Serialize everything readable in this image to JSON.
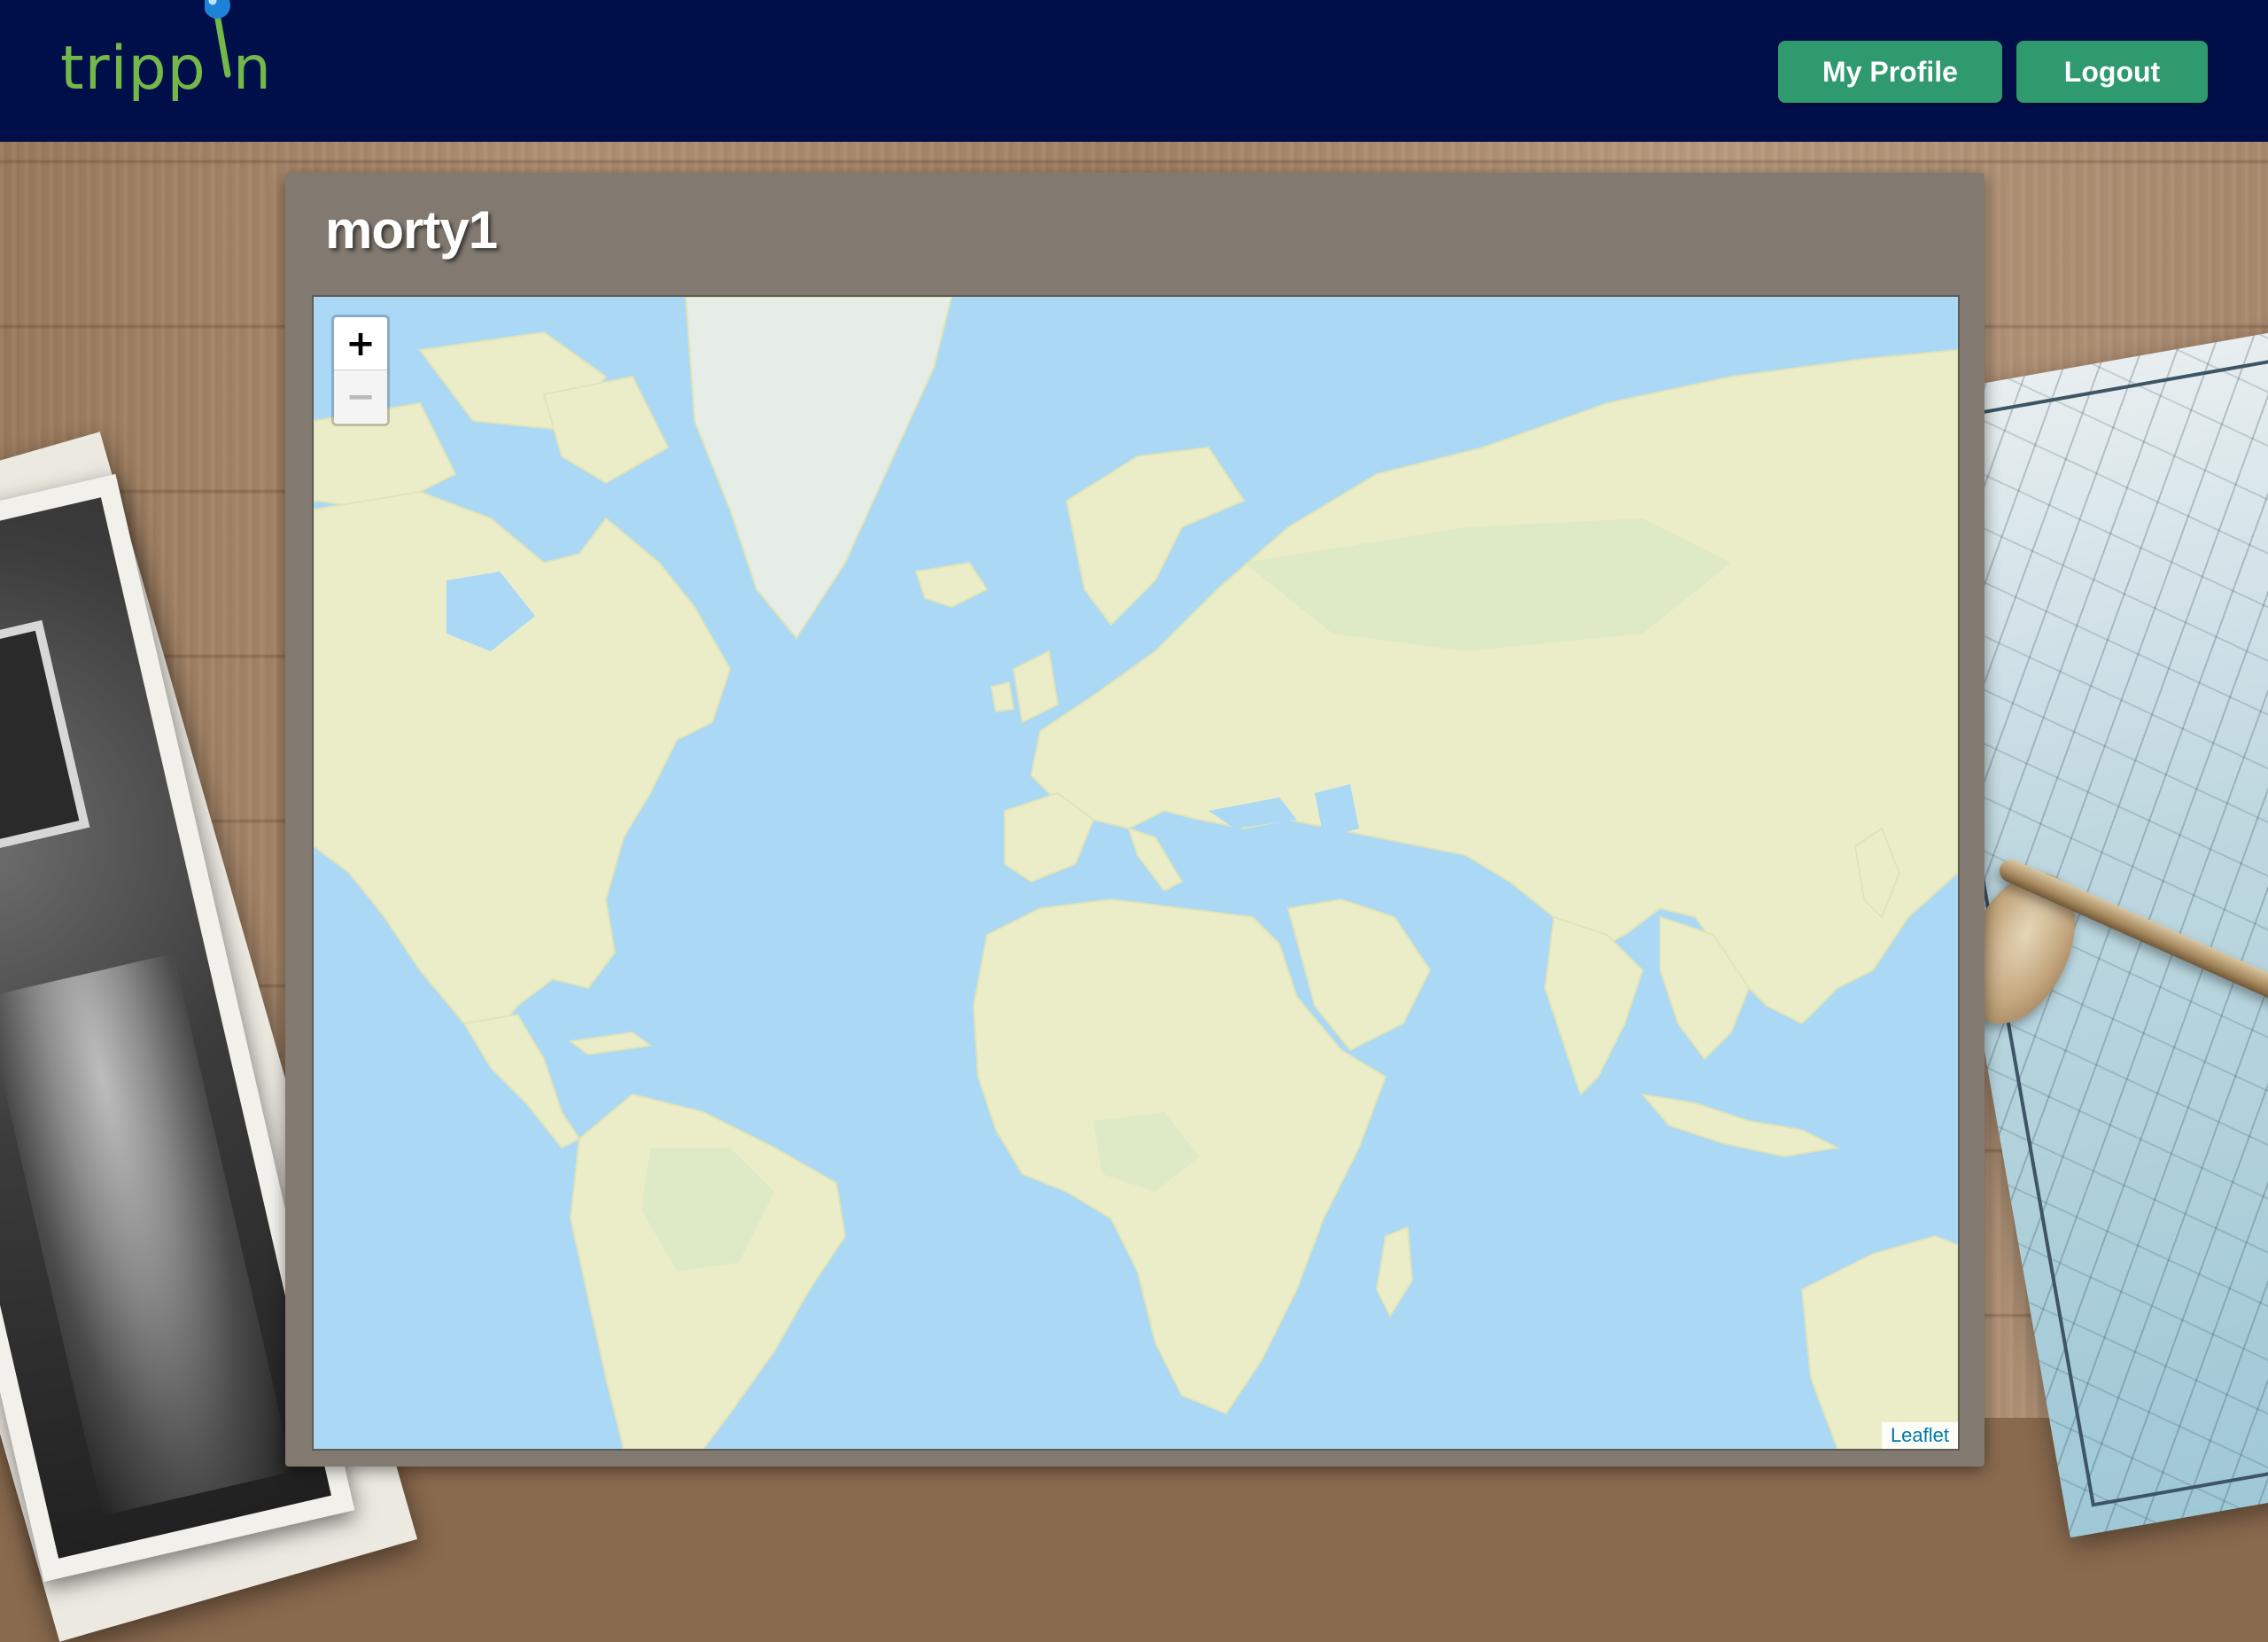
{
  "header": {
    "logo_text_a": "tripp",
    "logo_text_b": "n",
    "profile_button": "My Profile",
    "logout_button": "Logout"
  },
  "profile": {
    "username": "morty1"
  },
  "map": {
    "zoom_in": "+",
    "zoom_out": "−",
    "attribution": "Leaflet"
  },
  "colors": {
    "header_bg": "#000f4a",
    "button_green": "#2f9a6d",
    "logo_green": "#74b84a",
    "card_bg": "#827a70",
    "ocean": "#aad8f5",
    "land": "#eaedc8"
  }
}
